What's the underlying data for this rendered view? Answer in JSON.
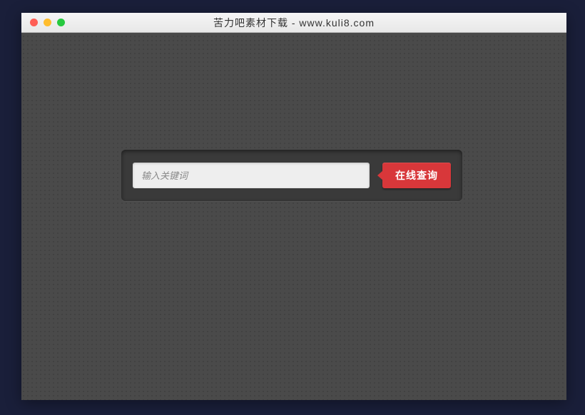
{
  "window": {
    "title": "苦力吧素材下载 - www.kuli8.com"
  },
  "search": {
    "placeholder": "输入关键词",
    "button_label": "在线查询"
  }
}
